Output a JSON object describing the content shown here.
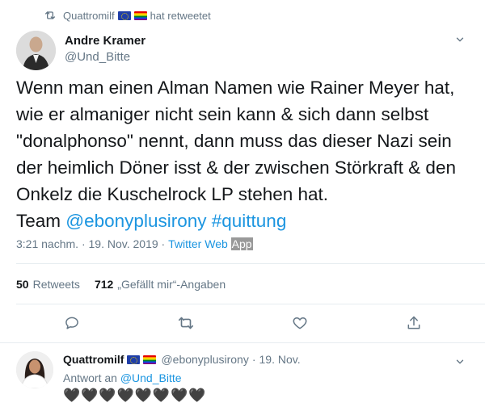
{
  "retweet_banner": {
    "retweeter": "Quattromilf",
    "suffix": "hat retweetet",
    "icon": "retweet-icon"
  },
  "tweet": {
    "author_name": "Andre Kramer",
    "author_handle": "@Und_Bitte",
    "text_main": "Wenn man einen Alman Namen wie Rainer Meyer hat,\nwie er almaniger nicht sein kann & sich dann selbst\n\"donalphonso\" nennt, dann muss das dieser Nazi sein\nder heimlich Döner isst & der zwischen Störkraft & den\nOnkelz die Kuschelrock LP stehen hat.\nTeam ",
    "mention": "@ebonyplusirony",
    "hashtag": "#quittung",
    "time": "3:21 nachm.",
    "separator": " · ",
    "date": "19. Nov. 2019",
    "source_prefix": "Twitter Web ",
    "source_highlight": "App",
    "retweets_count": "50",
    "retweets_label": "Retweets",
    "likes_count": "712",
    "likes_label": "„Gefällt mir“-Angaben"
  },
  "actions": [
    "reply-icon",
    "retweet-icon",
    "like-icon",
    "share-icon"
  ],
  "reply": {
    "name": "Quattromilf",
    "handle": "@ebonyplusirony",
    "separator": "·",
    "date": "19. Nov.",
    "reply_to_prefix": "Antwort an",
    "reply_to_handle": "@Und_Bitte",
    "text": "🖤🖤🖤🖤🖤🖤🖤🖤"
  },
  "colors": {
    "link": "#1b95e0",
    "secondary_text": "#657786",
    "divider": "#e6ecf0"
  }
}
